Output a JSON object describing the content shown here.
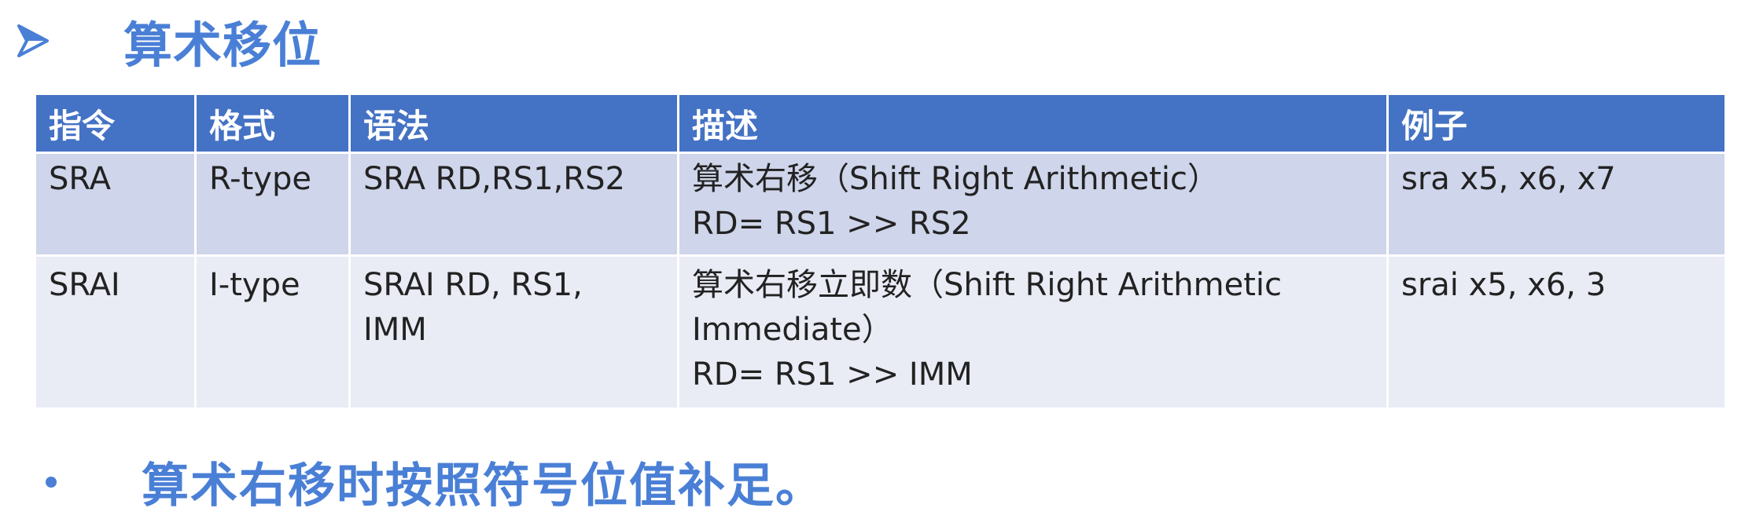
{
  "title": "算术移位",
  "table": {
    "headers": [
      "指令",
      "格式",
      "语法",
      "描述",
      "例子"
    ],
    "rows": [
      {
        "instruction": "SRA",
        "format": "R-type",
        "syntax": [
          "SRA RD,RS1,RS2"
        ],
        "description": [
          "算术右移（Shift Right Arithmetic）",
          "RD= RS1 >> RS2"
        ],
        "example": "sra x5, x6, x7"
      },
      {
        "instruction": "SRAI",
        "format": "I-type",
        "syntax": [
          "SRAI RD, RS1,",
          "IMM"
        ],
        "description": [
          "算术右移立即数（Shift Right Arithmetic",
          "Immediate）",
          "RD= RS1 >> IMM"
        ],
        "example": "srai x5, x6, 3"
      }
    ]
  },
  "note": "算术右移时按照符号位值补足。",
  "colors": {
    "accent": "#4a7fd6",
    "header_bg": "#4472c4",
    "row_dark": "#cfd5ea",
    "row_light": "#e9ebf5"
  },
  "icons": {
    "title_marker": "arrow-right-icon",
    "bullet": "bullet-dot-icon"
  }
}
